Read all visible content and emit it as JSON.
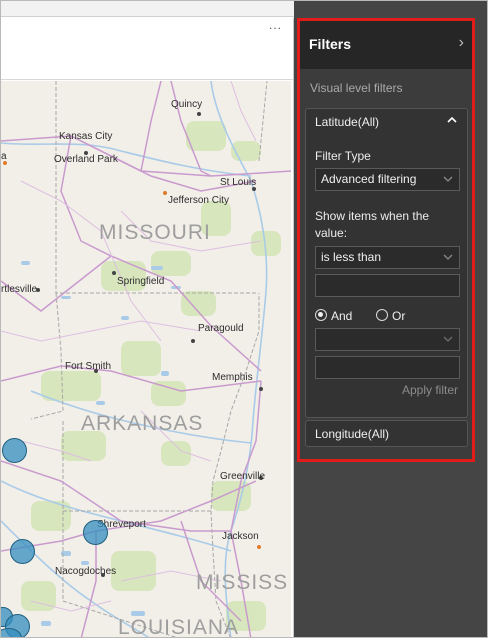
{
  "visual": {
    "more_options": "..."
  },
  "map": {
    "cities": [
      {
        "name": "Quincy"
      },
      {
        "name": "Kansas City"
      },
      {
        "name": "Overland Park"
      },
      {
        "name": "St Louis"
      },
      {
        "name": "Jefferson City"
      },
      {
        "name": "Springfield"
      },
      {
        "name": "rtlesville"
      },
      {
        "name": "Paragould"
      },
      {
        "name": "Fort Smith"
      },
      {
        "name": "Memphis"
      },
      {
        "name": "Greenville"
      },
      {
        "name": "Shreveport"
      },
      {
        "name": "Jackson"
      },
      {
        "name": "Nacogdoches"
      },
      {
        "name": "a"
      }
    ],
    "states": [
      {
        "name": "MISSOURI"
      },
      {
        "name": "ARKANSAS"
      },
      {
        "name": "MISSISS"
      },
      {
        "name": "LOUISIANA"
      }
    ]
  },
  "filters": {
    "title": "Filters",
    "collapse_icon": "chevron-right-icon",
    "section_label": "Visual level filters",
    "latitude": {
      "title": "Latitude(All)",
      "filter_type_label": "Filter Type",
      "filter_type_value": "Advanced filtering",
      "show_items_label": "Show items when the value:",
      "condition1": "is less than",
      "value1": "",
      "and_label": "And",
      "or_label": "Or",
      "logic_selected": "And",
      "condition2": "",
      "value2": "",
      "apply_label": "Apply filter"
    },
    "longitude": {
      "title": "Longitude(All)"
    }
  },
  "colors": {
    "highlight_border": "#e21b1b",
    "panel_bg": "#3c3c3c",
    "bubble": "#348ebf"
  }
}
